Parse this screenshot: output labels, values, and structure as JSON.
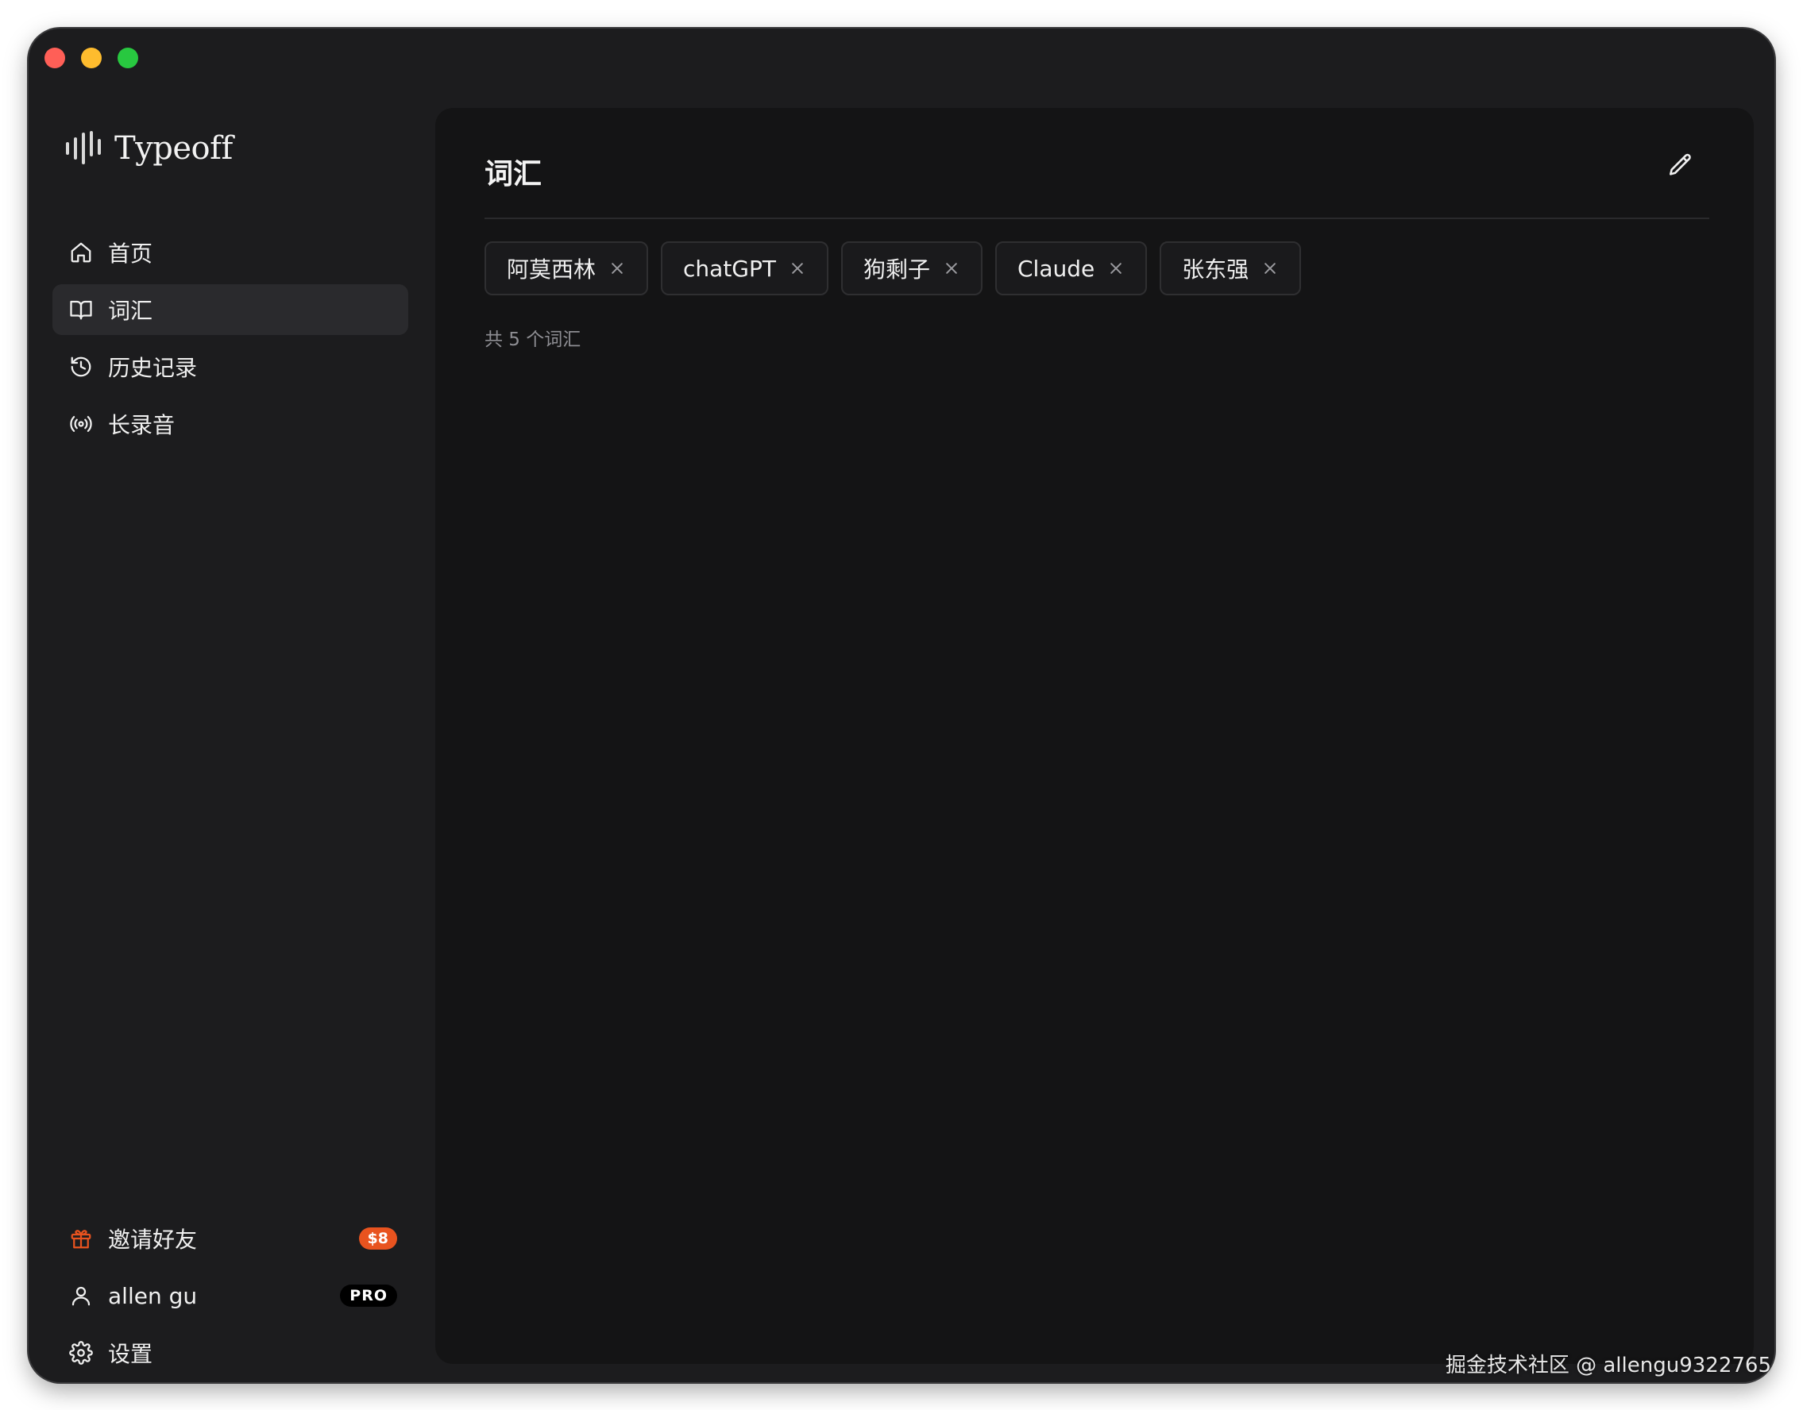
{
  "app": {
    "name": "Typeoff"
  },
  "sidebar": {
    "nav": [
      {
        "label": "首页",
        "icon": "home-icon",
        "active": false
      },
      {
        "label": "词汇",
        "icon": "book-icon",
        "active": true
      },
      {
        "label": "历史记录",
        "icon": "history-icon",
        "active": false
      },
      {
        "label": "长录音",
        "icon": "broadcast-icon",
        "active": false
      }
    ],
    "bottom": {
      "invite": {
        "label": "邀请好友",
        "badge": "$8",
        "icon": "gift-icon"
      },
      "user": {
        "label": "allen gu",
        "badge": "PRO",
        "icon": "user-icon"
      },
      "settings": {
        "label": "设置",
        "icon": "gear-icon"
      }
    }
  },
  "main": {
    "title": "词汇",
    "tags": [
      "阿莫西林",
      "chatGPT",
      "狗剩子",
      "Claude",
      "张东强"
    ],
    "count_text": "共 5 个词汇"
  },
  "watermark": "掘金技术社区 @ allengu9322765",
  "colors": {
    "window_bg": "#1c1c1e",
    "main_bg": "#141415",
    "active_item": "#2a2a2d",
    "badge_orange": "#e8531f",
    "invite_icon": "#e8531f"
  }
}
